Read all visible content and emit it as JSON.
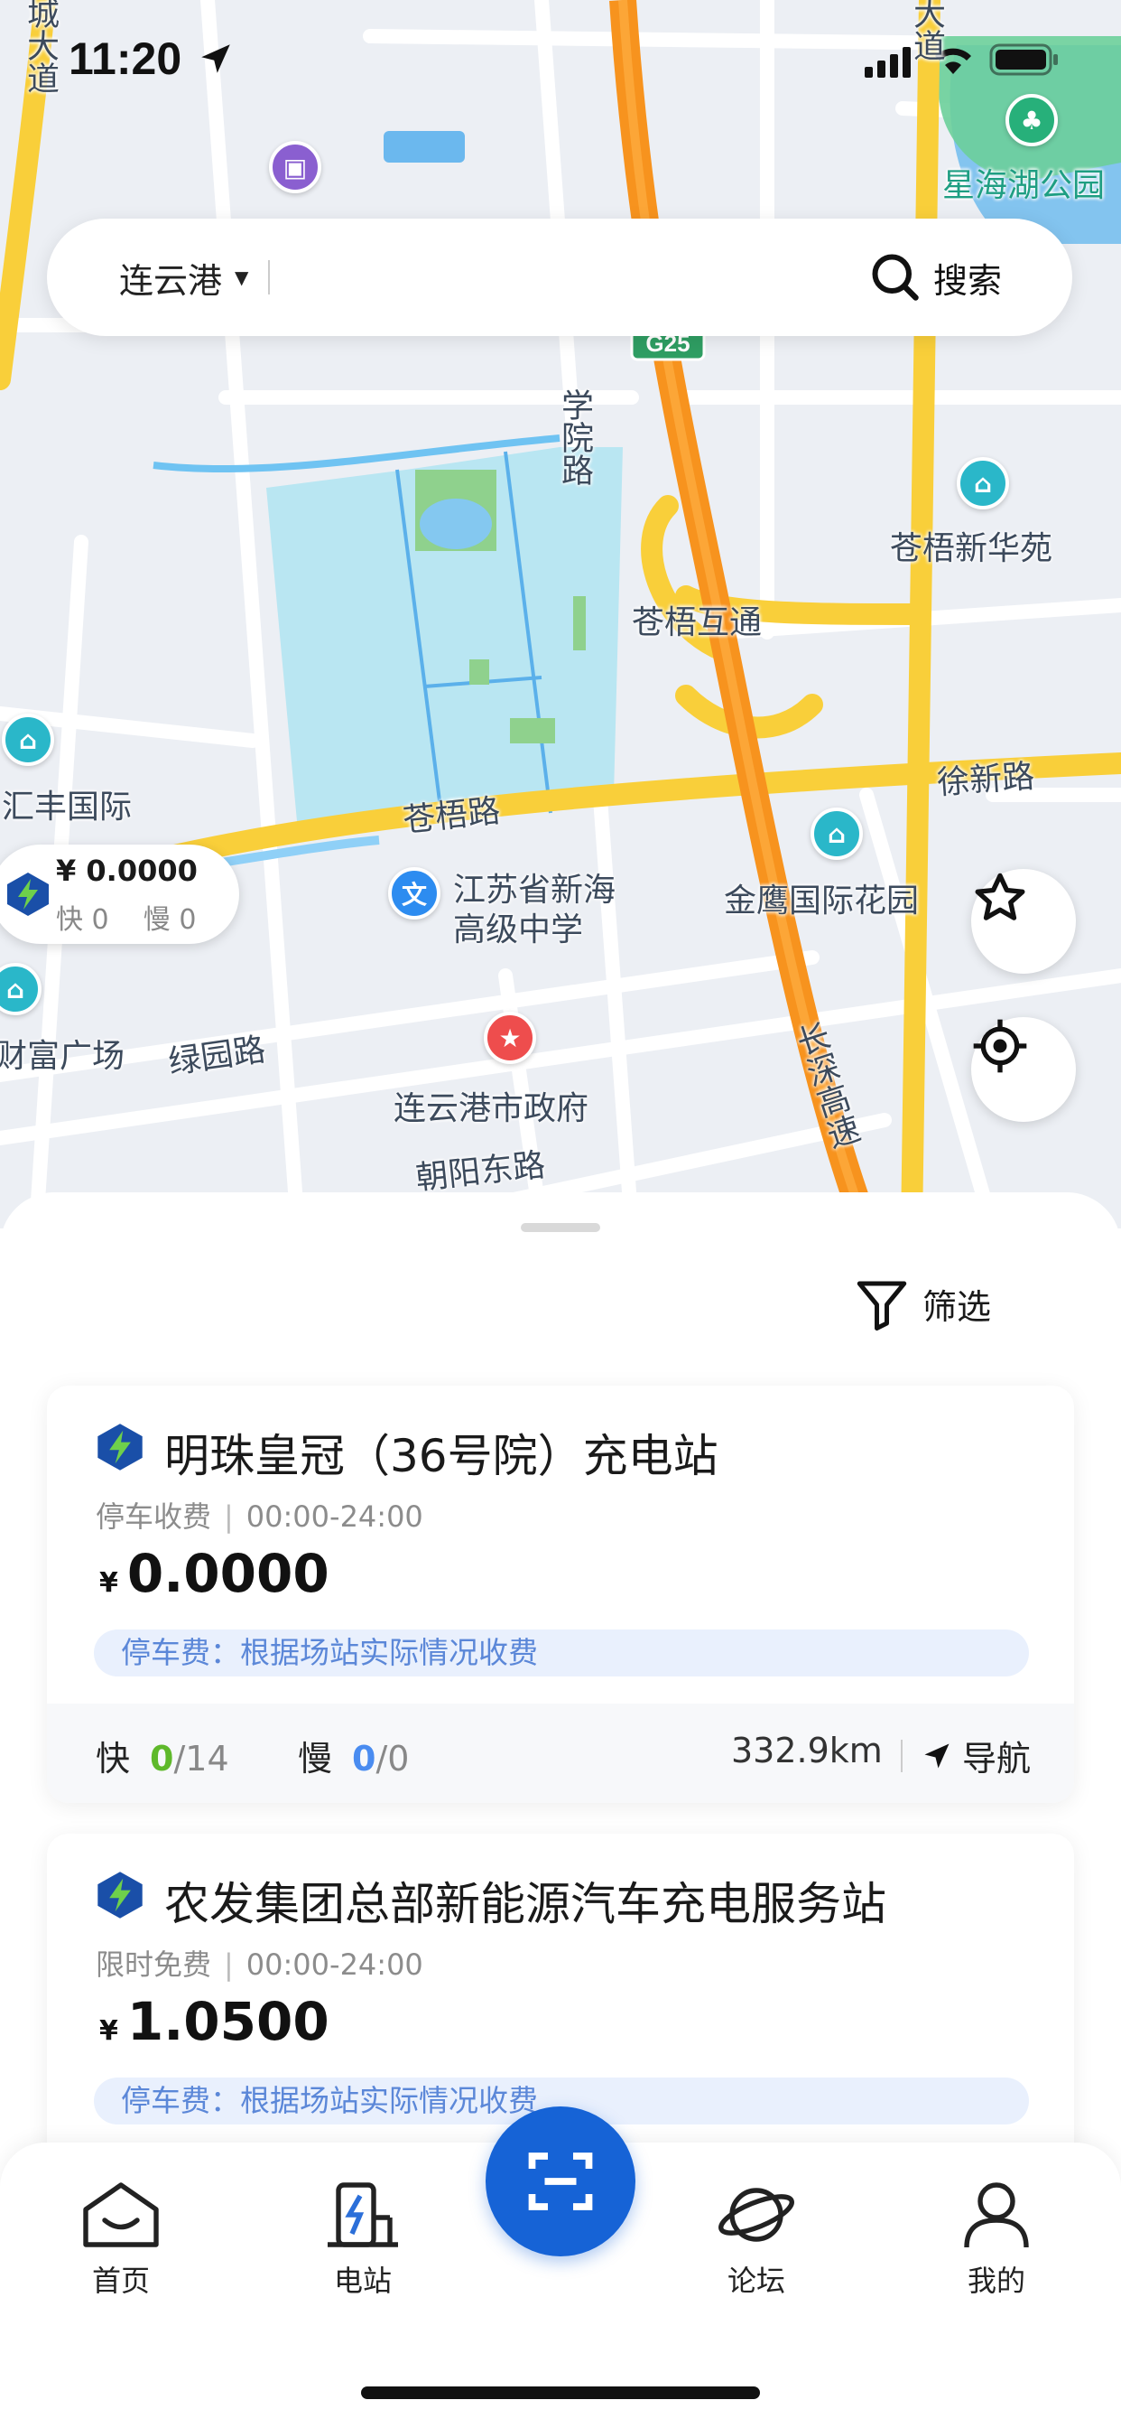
{
  "status_bar": {
    "time": "11:20"
  },
  "search": {
    "city": "连云港",
    "button_label": "搜索"
  },
  "map": {
    "labels": {
      "cheng_da_dao": "城大道",
      "da_dao_top": "大道",
      "xinghai_park": "星海湖公园",
      "g25": "G25",
      "xueyuan_road": "学院路",
      "cangwu_xinhua": "苍梧新华苑",
      "cangwu_interchange": "苍梧互通",
      "huifeng": "汇丰国际",
      "cangwu_road": "苍梧路",
      "xuxin_road": "徐新路",
      "school_line1": "江苏省新海",
      "school_line2": "高级中学",
      "jinying": "金鹰国际花园",
      "caifu": "财富广场",
      "lvyuan_road": "绿园路",
      "gov": "连云港市政府",
      "chaoyang_road": "朝阳东路",
      "expressway": "长深高速"
    },
    "marker": {
      "price": "¥ 0.0000",
      "fast_label": "快",
      "fast_count": "0",
      "slow_label": "慢",
      "slow_count": "0"
    }
  },
  "sheet": {
    "filter_label": "筛选"
  },
  "stations": [
    {
      "name": "明珠皇冠（36号院）充电站",
      "fee_type": "停车收费",
      "hours": "00:00-24:00",
      "currency": "¥",
      "price": "0.0000",
      "parking_note": "停车费：根据场站实际情况收费",
      "fast_label": "快",
      "fast_available": "0",
      "fast_total": "/14",
      "slow_label": "慢",
      "slow_available": "0",
      "slow_total": "/0",
      "distance": "332.9km",
      "nav_label": "导航"
    },
    {
      "name": "农发集团总部新能源汽车充电服务站",
      "fee_type": "限时免费",
      "hours": "00:00-24:00",
      "currency": "¥",
      "price": "1.0500",
      "parking_note": "停车费：根据场站实际情况收费"
    }
  ],
  "tabbar": {
    "home": "首页",
    "stations": "电站",
    "forum": "论坛",
    "mine": "我的"
  },
  "colors": {
    "brand_blue": "#1663d6",
    "fast_green": "#5fb92b",
    "slow_blue": "#4a8cf0",
    "highway_orange": "#f7931e",
    "road_yellow": "#f9cf3a"
  }
}
